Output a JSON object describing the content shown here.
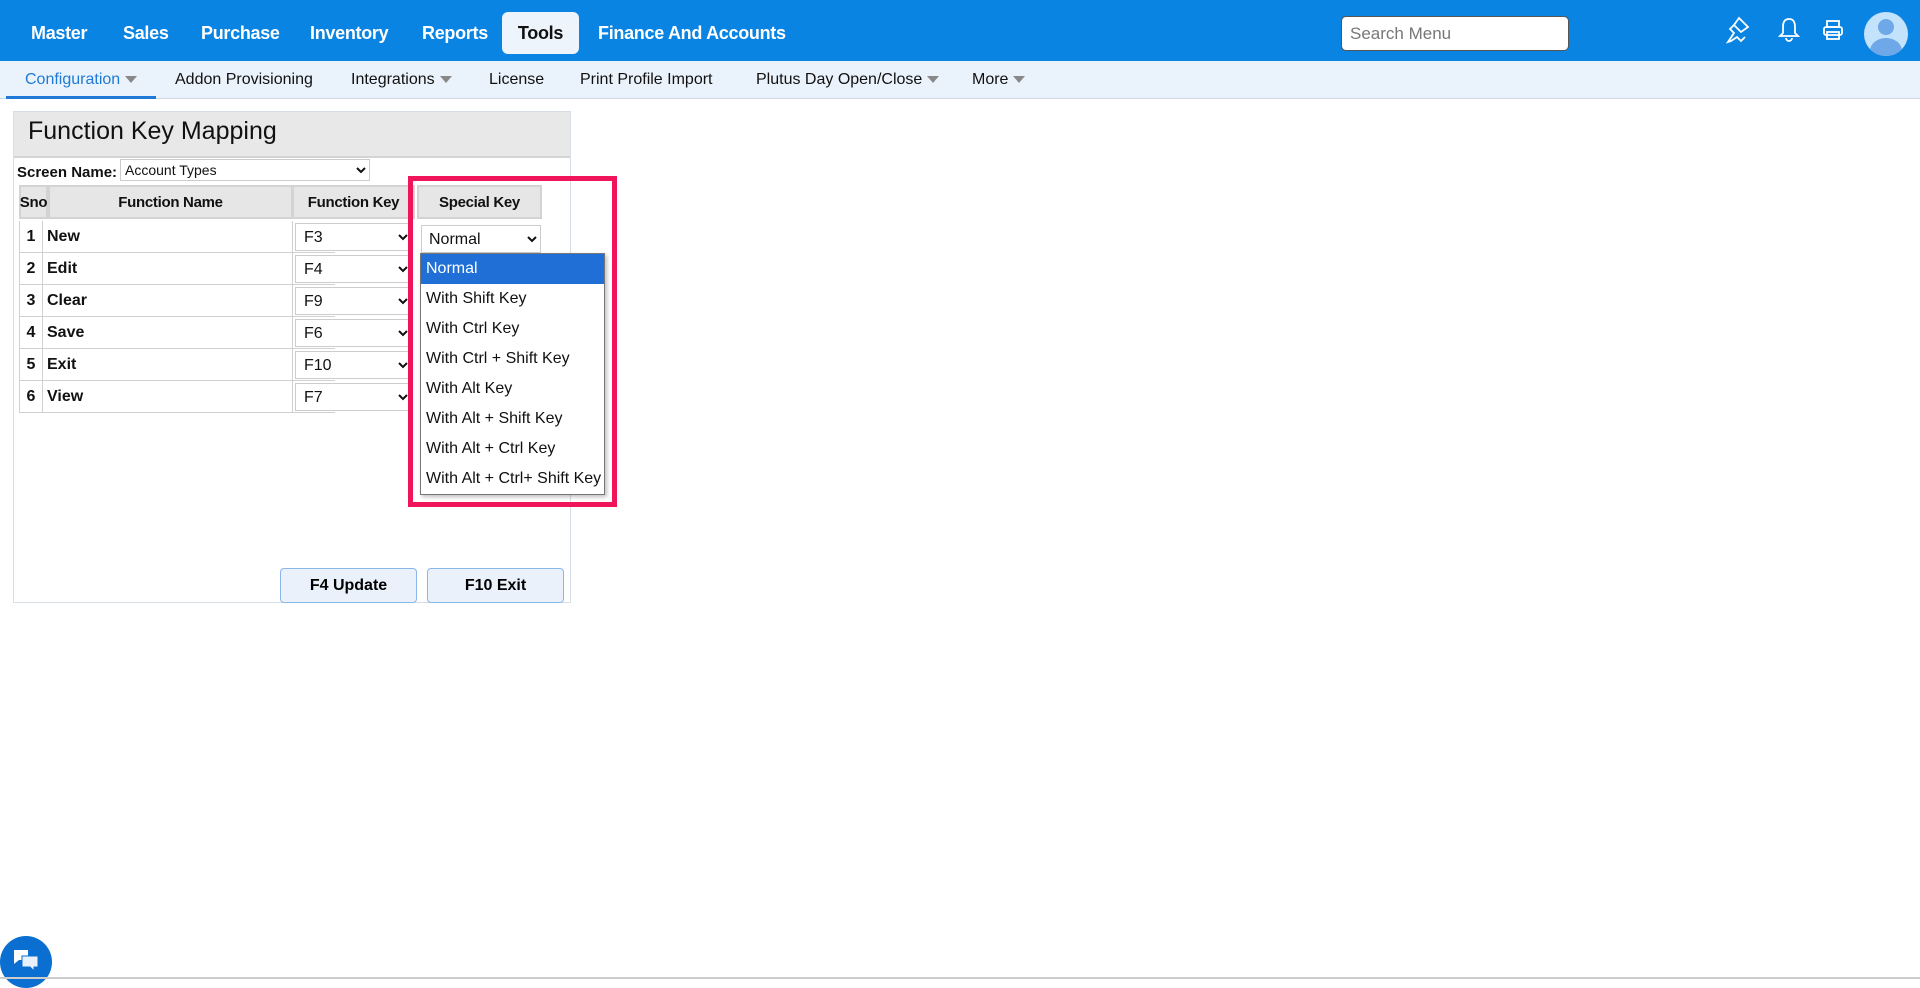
{
  "topnav": {
    "items": [
      "Master",
      "Sales",
      "Purchase",
      "Inventory",
      "Reports",
      "Tools",
      "Finance And Accounts"
    ],
    "active": "Tools",
    "search_placeholder": "Search Menu"
  },
  "subnav": {
    "items": [
      "Configuration",
      "Addon Provisioning",
      "Integrations",
      "License",
      "Print Profile Import",
      "Plutus Day Open/Close",
      "More"
    ]
  },
  "panel": {
    "title": "Function Key Mapping",
    "screen_name_label": "Screen Name:",
    "screen_name_value": "Account Types",
    "headers": [
      "Sno",
      "Function Name",
      "Function Key",
      "Special Key"
    ],
    "rows": [
      {
        "sno": "1",
        "name": "New",
        "key": "F3"
      },
      {
        "sno": "2",
        "name": "Edit",
        "key": "F4"
      },
      {
        "sno": "3",
        "name": "Clear",
        "key": "F9"
      },
      {
        "sno": "4",
        "name": "Save",
        "key": "F6"
      },
      {
        "sno": "5",
        "name": "Exit",
        "key": "F10"
      },
      {
        "sno": "6",
        "name": "View",
        "key": "F7"
      }
    ],
    "special_key_value": "Normal",
    "special_key_options": [
      "Normal",
      "With Shift Key",
      "With Ctrl Key",
      "With Ctrl + Shift Key",
      "With Alt Key",
      "With Alt + Shift Key",
      "With Alt + Ctrl Key",
      "With Alt + Ctrl+ Shift Key"
    ],
    "update_button": "F4 Update",
    "exit_button": "F10 Exit"
  },
  "colors": {
    "brand": "#0a84e3",
    "highlight": "#f0145a",
    "selected": "#1f6fd6"
  }
}
